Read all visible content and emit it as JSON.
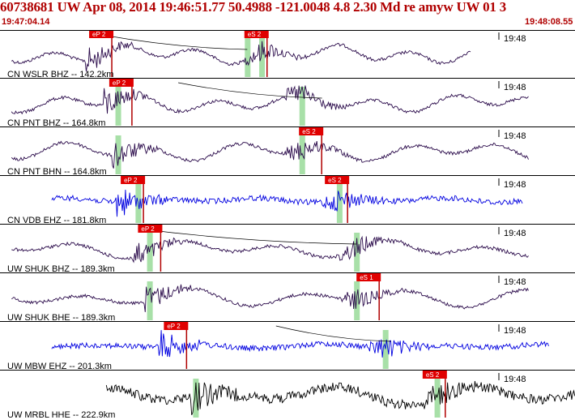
{
  "header": {
    "title": "60738681 UW Apr 08, 2014 19:46:51.77    50.4988 -121.0048  4.8 2.30 Md re amyw UW 01    3",
    "time_start": "19:47:04.14",
    "time_end": "19:48:08.55",
    "title_color": "#b00000"
  },
  "colors": {
    "trace_dark": "#2a0a4a",
    "trace_blue": "#0000e0",
    "trace_black": "#000000",
    "pick_box": "#e00000",
    "pick_text": "#ffffff",
    "green_band": "#a8e0a8",
    "divider": "#000000"
  },
  "panels": [
    {
      "label": "CN WSLR BHZ -- 142.2km",
      "time_tick": "19:48",
      "color": "dark",
      "picks": [
        {
          "label": "eP 2",
          "t": 0.155
        },
        {
          "label": "eS 2",
          "t": 0.425
        }
      ],
      "green": [
        0.43,
        0.455
      ]
    },
    {
      "label": "CN PNT BHZ -- 164.8km",
      "time_tick": "19:48",
      "color": "dark",
      "picks": [
        {
          "label": "eP 2",
          "t": 0.19
        }
      ],
      "green": [
        0.205,
        0.525
      ]
    },
    {
      "label": "CN PNT BHN -- 164.8km",
      "time_tick": "19:48",
      "color": "dark",
      "picks": [
        {
          "label": "eS 2",
          "t": 0.52
        }
      ],
      "green": [
        0.205,
        0.525
      ]
    },
    {
      "label": "CN VDB EHZ -- 181.8km",
      "time_tick": "19:48",
      "color": "blue",
      "picks": [
        {
          "label": "eP 2",
          "t": 0.21
        },
        {
          "label": "eS 2",
          "t": 0.565
        }
      ],
      "green": [
        0.24,
        0.59
      ]
    },
    {
      "label": "UW SHUK BHZ -- 189.3km",
      "time_tick": "19:48",
      "color": "dark",
      "picks": [
        {
          "label": "eP 2",
          "t": 0.24
        }
      ],
      "green": [
        0.26,
        0.62
      ]
    },
    {
      "label": "UW SHUK BHE -- 189.3km",
      "time_tick": "19:48",
      "color": "dark",
      "picks": [
        {
          "label": "eS 1",
          "t": 0.62
        }
      ],
      "green": [
        0.26,
        0.62
      ]
    },
    {
      "label": "UW MBW EHZ -- 201.3km",
      "time_tick": "19:48",
      "color": "blue",
      "picks": [
        {
          "label": "eP 2",
          "t": 0.285
        }
      ],
      "green": [
        0.67
      ]
    },
    {
      "label": "UW MRBL HHE -- 222.9km",
      "time_tick": "19:48",
      "color": "black",
      "picks": [
        {
          "label": "eS 2",
          "t": 0.735
        }
      ],
      "green": [
        0.34,
        0.76
      ]
    }
  ]
}
